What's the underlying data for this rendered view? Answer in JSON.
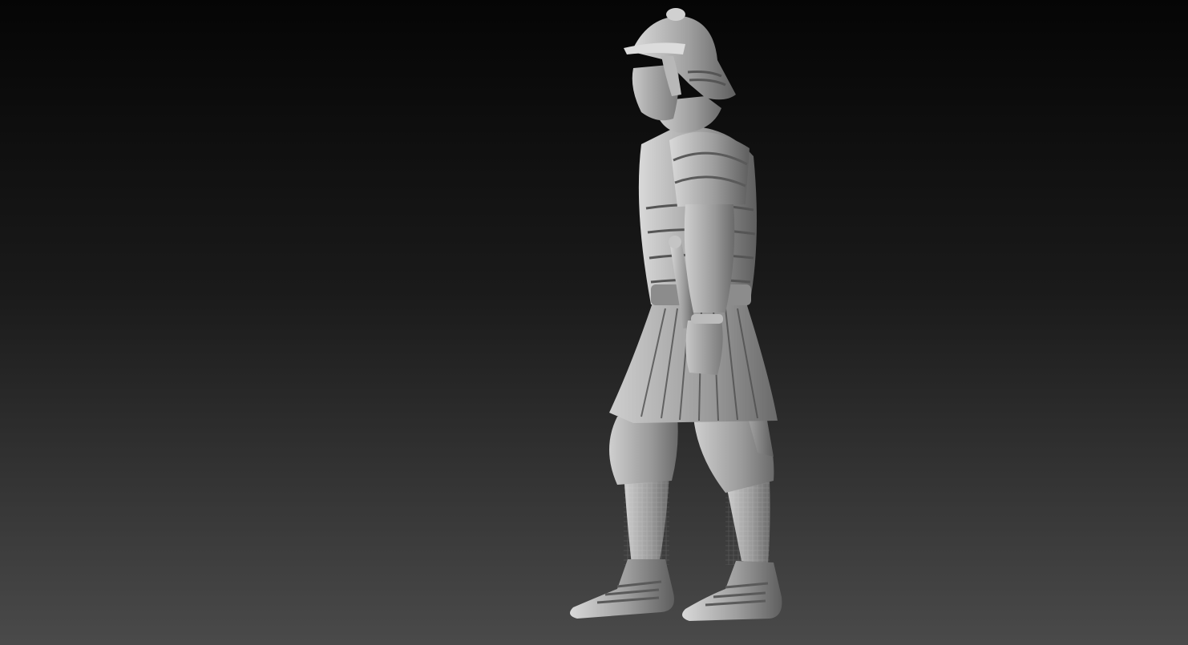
{
  "scene": {
    "subject": "sculpted-figure",
    "background_top_color": "#050505",
    "background_bottom_color": "#4a4a4a",
    "material_light_color": "#e6e6e6",
    "material_mid_color": "#a8a8a8",
    "material_dark_color": "#5c5c5c"
  }
}
